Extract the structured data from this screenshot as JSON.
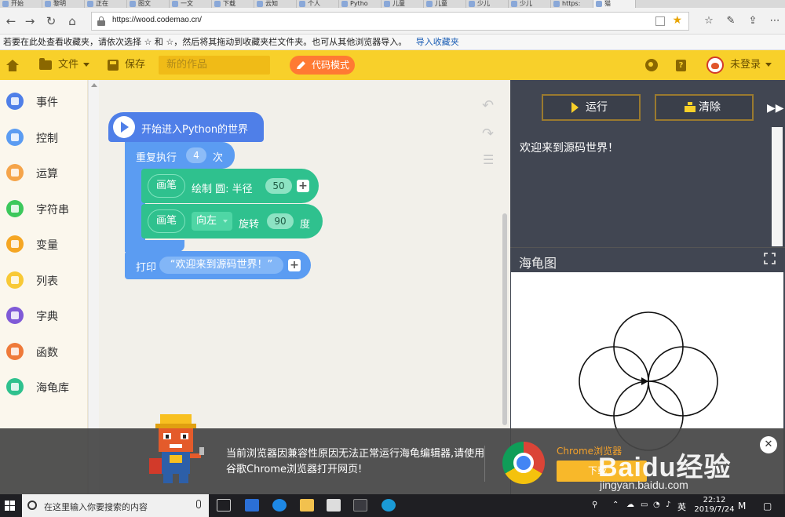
{
  "browser": {
    "tabs": [
      "开始",
      "黎明",
      "正在",
      "图文",
      "一文",
      "下载",
      "云知",
      "个人",
      "Pytho",
      "儿童",
      "儿童",
      "少儿",
      "少儿",
      "https:",
      "猫"
    ],
    "url": "https://wood.codemao.cn/",
    "favorites_hint": "若要在此处查看收藏夹，请依次选择 ☆ 和 ☆，然后将其拖动到收藏夹栏文件夹。也可从其他浏览器导入。",
    "favorites_import_link": "导入收藏夹"
  },
  "app": {
    "menu_file": "文件",
    "save": "保存",
    "project_name_placeholder": "新的作品",
    "code_mode": "代码模式",
    "login": "未登录"
  },
  "sidebar": {
    "items": [
      {
        "label": "事件",
        "color": "#4f7fe8",
        "icon": "toggle-icon"
      },
      {
        "label": "控制",
        "color": "#5b9cf2",
        "icon": "gamepad-icon"
      },
      {
        "label": "运算",
        "color": "#f5a44a",
        "icon": "calculator-icon"
      },
      {
        "label": "字符串",
        "color": "#3cc85c",
        "icon": "letter-a-icon"
      },
      {
        "label": "变量",
        "color": "#f5a623",
        "icon": "variable-x-icon"
      },
      {
        "label": "列表",
        "color": "#f8c936",
        "icon": "list-icon"
      },
      {
        "label": "字典",
        "color": "#7f5ad7",
        "icon": "book-icon"
      },
      {
        "label": "函数",
        "color": "#ef7a3a",
        "icon": "function-icon"
      },
      {
        "label": "海龟库",
        "color": "#2fc18e",
        "icon": "turtle-icon"
      }
    ]
  },
  "blocks": {
    "hat": "开始进入Python的世界",
    "repeat_prefix": "重复执行",
    "repeat_count": "4",
    "repeat_suffix": "次",
    "pen_label": "画笔",
    "draw_circle": "绘制 圆: 半径",
    "radius": "50",
    "direction": "向左",
    "rotate": "旋转",
    "angle": "90",
    "degree": "度",
    "print_label": "打印",
    "print_string": "“欢迎来到源码世界！”"
  },
  "right_panel": {
    "run": "运行",
    "clear": "清除",
    "console_output": "欢迎来到源码世界！",
    "turtle_title": "海龟图"
  },
  "banner": {
    "message": "当前浏览器因兼容性原因无法正常运行海龟编辑器,请使用谷歌Chrome浏览器打开网页!",
    "chrome_label": "Chrome浏览器",
    "download": "下载",
    "watermark": "Baidu经验",
    "watermark_url": "jingyan.baidu.com"
  },
  "taskbar": {
    "search_placeholder": "在这里输入你要搜索的内容",
    "ime": "英",
    "time": "22:12",
    "date": "2019/7/24"
  }
}
